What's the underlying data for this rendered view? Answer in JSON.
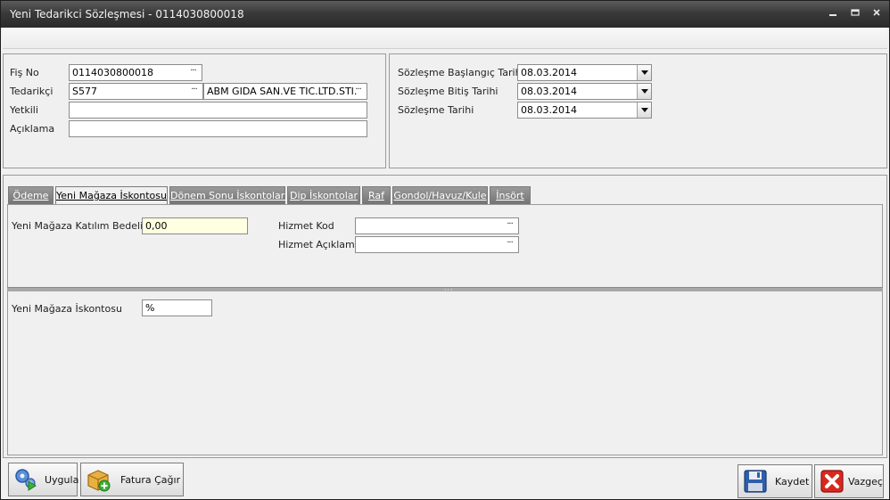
{
  "window": {
    "title": "Yeni Tedarikci Sözleşmesi - 0114030800018",
    "controls": [
      "minimize",
      "maximize",
      "close"
    ]
  },
  "header_left": {
    "fis_no_label": "Fiş No",
    "fis_no_value": "0114030800018",
    "tedarikci_label": "Tedarikçi",
    "tedarikci_code": "S577",
    "tedarikci_name": "ABM GIDA SAN.VE TIC.LTD.STI.",
    "yetkili_label": "Yetkili",
    "yetkili_value": "",
    "aciklama_label": "Açıklama",
    "aciklama_value": ""
  },
  "header_right": {
    "baslangic_label": "Sözleşme Başlangıç Tarihi",
    "baslangic_value": "08.03.2014",
    "bitis_label": "Sözleşme Bitiş Tarihi",
    "bitis_value": "08.03.2014",
    "tarih_label": "Sözleşme Tarihi",
    "tarih_value": "08.03.2014"
  },
  "tabs": [
    {
      "label": "Ödeme",
      "active": false
    },
    {
      "label": "Yeni Mağaza İskontosu",
      "active": true
    },
    {
      "label": "Dönem Sonu İskontoları",
      "active": false
    },
    {
      "label": "Dip İskontolar",
      "active": false
    },
    {
      "label": "Raf",
      "active": false
    },
    {
      "label": "Gondol/Havuz/Kule",
      "active": false
    },
    {
      "label": "İnsört",
      "active": false
    }
  ],
  "tab_content": {
    "katilim_label": "Yeni Mağaza Katılım Bedeli",
    "katilim_value": "0,00",
    "hizmet_kod_label": "Hizmet Kod",
    "hizmet_kod_value": "",
    "hizmet_aciklama_label": "Hizmet Açıklama",
    "hizmet_aciklama_value": "",
    "iskonto_label": "Yeni Mağaza İskontosu",
    "iskonto_value": "%"
  },
  "buttons": {
    "uygula": "Uygula",
    "fatura": "Fatura Çağır",
    "kaydet": "Kaydet",
    "vazgec": "Vazgeç"
  },
  "ellipsis": "···"
}
